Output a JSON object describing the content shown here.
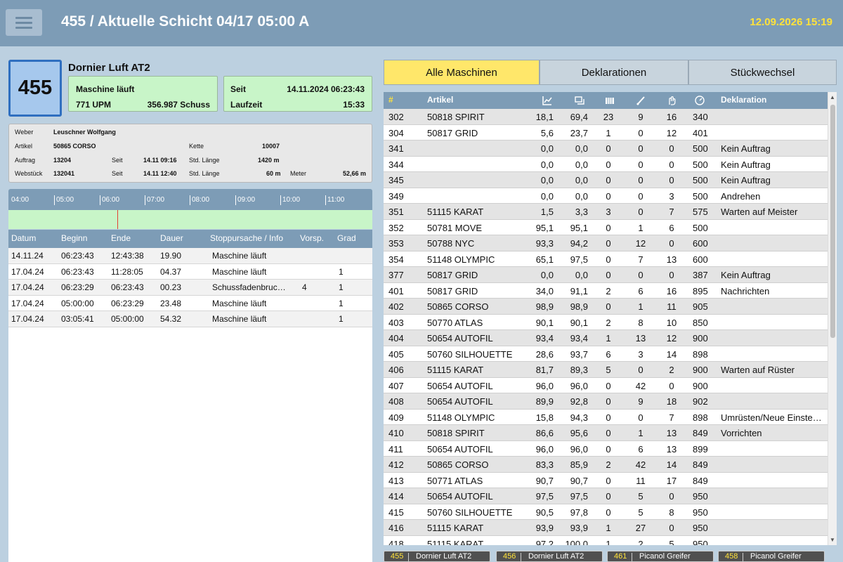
{
  "header": {
    "title": "455 / Aktuelle Schicht 04/17 05:00 A",
    "clock": "12.09.2026 15:19",
    "menu_icon": "hamburger-icon"
  },
  "machine": {
    "number": "455",
    "name": "Dornier Luft AT2",
    "status": "Maschine läuft",
    "upm": "771 UPM",
    "schuss": "356.987 Schuss",
    "seit_label": "Seit",
    "seit_value": "14.11.2024 06:23:43",
    "laufzeit_label": "Laufzeit",
    "laufzeit_value": "15:33"
  },
  "info": {
    "weber_label": "Weber",
    "weber_value": "Leuschner Wolfgang",
    "artikel_label": "Artikel",
    "artikel_value": "50865 CORSO",
    "kette_label": "Kette",
    "kette_value": "10007",
    "auftrag_label": "Auftrag",
    "auftrag_value": "13204",
    "auftrag_seit_label": "Seit",
    "auftrag_seit_value": "14.11 09:16",
    "auftrag_len_label": "Std. Länge",
    "auftrag_len_value": "1420 m",
    "webstueck_label": "Webstück",
    "webstueck_value": "132041",
    "webstueck_seit_label": "Seit",
    "webstueck_seit_value": "14.11 12:40",
    "webstueck_len_label": "Std. Länge",
    "webstueck_len_value": "60 m",
    "meter_label": "Meter",
    "meter_value": "52,66 m"
  },
  "timeline": {
    "ticks": [
      "04:00",
      "05:00",
      "06:00",
      "07:00",
      "08:00",
      "09:00",
      "10:00",
      "11:00"
    ],
    "now_marker_color": "#e34234"
  },
  "log": {
    "columns": [
      "Datum",
      "Beginn",
      "Ende",
      "Dauer",
      "Stoppursache / Info",
      "Vorsp.",
      "Grad"
    ],
    "rows": [
      [
        "14.11.24",
        "06:23:43",
        "12:43:38",
        "19.90",
        "Maschine läuft",
        "",
        ""
      ],
      [
        "17.04.24",
        "06:23:43",
        "11:28:05",
        "04.37",
        "Maschine läuft",
        "",
        "1"
      ],
      [
        "17.04.24",
        "06:23:29",
        "06:23:43",
        "00.23",
        "Schussfadenbruc…",
        "4",
        "1"
      ],
      [
        "17.04.24",
        "05:00:00",
        "06:23:29",
        "23.48",
        "Maschine läuft",
        "",
        "1"
      ],
      [
        "17.04.24",
        "03:05:41",
        "05:00:00",
        "54.32",
        "Maschine läuft",
        "",
        "1"
      ]
    ]
  },
  "tabs": [
    {
      "label": "Alle Maschinen",
      "active": true
    },
    {
      "label": "Deklarationen",
      "active": false
    },
    {
      "label": "Stückwechsel",
      "active": false
    }
  ],
  "grid": {
    "columns": {
      "num": "#",
      "artikel": "Artikel",
      "icons": [
        "efficiency-chart-icon",
        "production-icon",
        "warp-beam-icon",
        "weft-break-icon",
        "warp-break-icon",
        "speed-icon"
      ],
      "deklaration": "Deklaration"
    },
    "rows": [
      [
        "302",
        "50818 SPIRIT",
        "18,1",
        "69,4",
        "23",
        "9",
        "16",
        "340",
        ""
      ],
      [
        "304",
        "50817 GRID",
        "5,6",
        "23,7",
        "1",
        "0",
        "12",
        "401",
        ""
      ],
      [
        "341",
        "",
        "0,0",
        "0,0",
        "0",
        "0",
        "0",
        "500",
        "Kein Auftrag"
      ],
      [
        "344",
        "",
        "0,0",
        "0,0",
        "0",
        "0",
        "0",
        "500",
        "Kein Auftrag"
      ],
      [
        "345",
        "",
        "0,0",
        "0,0",
        "0",
        "0",
        "0",
        "500",
        "Kein Auftrag"
      ],
      [
        "349",
        "",
        "0,0",
        "0,0",
        "0",
        "0",
        "3",
        "500",
        "Andrehen"
      ],
      [
        "351",
        "51115 KARAT",
        "1,5",
        "3,3",
        "3",
        "0",
        "7",
        "575",
        "Warten auf Meister"
      ],
      [
        "352",
        "50781 MOVE",
        "95,1",
        "95,1",
        "0",
        "1",
        "6",
        "500",
        ""
      ],
      [
        "353",
        "50788 NYC",
        "93,3",
        "94,2",
        "0",
        "12",
        "0",
        "600",
        ""
      ],
      [
        "354",
        "51148 OLYMPIC",
        "65,1",
        "97,5",
        "0",
        "7",
        "13",
        "600",
        ""
      ],
      [
        "377",
        "50817 GRID",
        "0,0",
        "0,0",
        "0",
        "0",
        "0",
        "387",
        "Kein Auftrag"
      ],
      [
        "401",
        "50817 GRID",
        "34,0",
        "91,1",
        "2",
        "6",
        "16",
        "895",
        "Nachrichten"
      ],
      [
        "402",
        "50865 CORSO",
        "98,9",
        "98,9",
        "0",
        "1",
        "11",
        "905",
        ""
      ],
      [
        "403",
        "50770 ATLAS",
        "90,1",
        "90,1",
        "2",
        "8",
        "10",
        "850",
        ""
      ],
      [
        "404",
        "50654 AUTOFIL",
        "93,4",
        "93,4",
        "1",
        "13",
        "12",
        "900",
        ""
      ],
      [
        "405",
        "50760 SILHOUETTE",
        "28,6",
        "93,7",
        "6",
        "3",
        "14",
        "898",
        ""
      ],
      [
        "406",
        "51115 KARAT",
        "81,7",
        "89,3",
        "5",
        "0",
        "2",
        "900",
        "Warten auf Rüster"
      ],
      [
        "407",
        "50654 AUTOFIL",
        "96,0",
        "96,0",
        "0",
        "42",
        "0",
        "900",
        ""
      ],
      [
        "408",
        "50654 AUTOFIL",
        "89,9",
        "92,8",
        "0",
        "9",
        "18",
        "902",
        ""
      ],
      [
        "409",
        "51148 OLYMPIC",
        "15,8",
        "94,3",
        "0",
        "0",
        "7",
        "898",
        "Umrüsten/Neue Einste…"
      ],
      [
        "410",
        "50818 SPIRIT",
        "86,6",
        "95,6",
        "0",
        "1",
        "13",
        "849",
        "Vorrichten"
      ],
      [
        "411",
        "50654 AUTOFIL",
        "96,0",
        "96,0",
        "0",
        "6",
        "13",
        "899",
        ""
      ],
      [
        "412",
        "50865 CORSO",
        "83,3",
        "85,9",
        "2",
        "42",
        "14",
        "849",
        ""
      ],
      [
        "413",
        "50771 ATLAS",
        "90,7",
        "90,7",
        "0",
        "11",
        "17",
        "849",
        ""
      ],
      [
        "414",
        "50654 AUTOFIL",
        "97,5",
        "97,5",
        "0",
        "5",
        "0",
        "950",
        ""
      ],
      [
        "415",
        "50760 SILHOUETTE",
        "90,5",
        "97,8",
        "0",
        "5",
        "8",
        "950",
        ""
      ],
      [
        "416",
        "51115 KARAT",
        "93,9",
        "93,9",
        "1",
        "27",
        "0",
        "950",
        ""
      ],
      [
        "418",
        "51115 KARAT",
        "97,2",
        "100,0",
        "1",
        "2",
        "5",
        "950",
        ""
      ]
    ]
  },
  "bottom_tiles": [
    {
      "num": "455",
      "name": "Dornier Luft AT2"
    },
    {
      "num": "456",
      "name": "Dornier Luft AT2"
    },
    {
      "num": "461",
      "name": "Picanol Greifer"
    },
    {
      "num": "458",
      "name": "Picanol Greifer"
    }
  ],
  "colors": {
    "header_bg": "#7d9cb6",
    "page_bg": "#bcd0e0",
    "running_green": "#c8f5c8",
    "active_tab": "#ffe76a",
    "accent_yellow": "#ffe23a",
    "machine_blue": "#2f6fc0"
  }
}
